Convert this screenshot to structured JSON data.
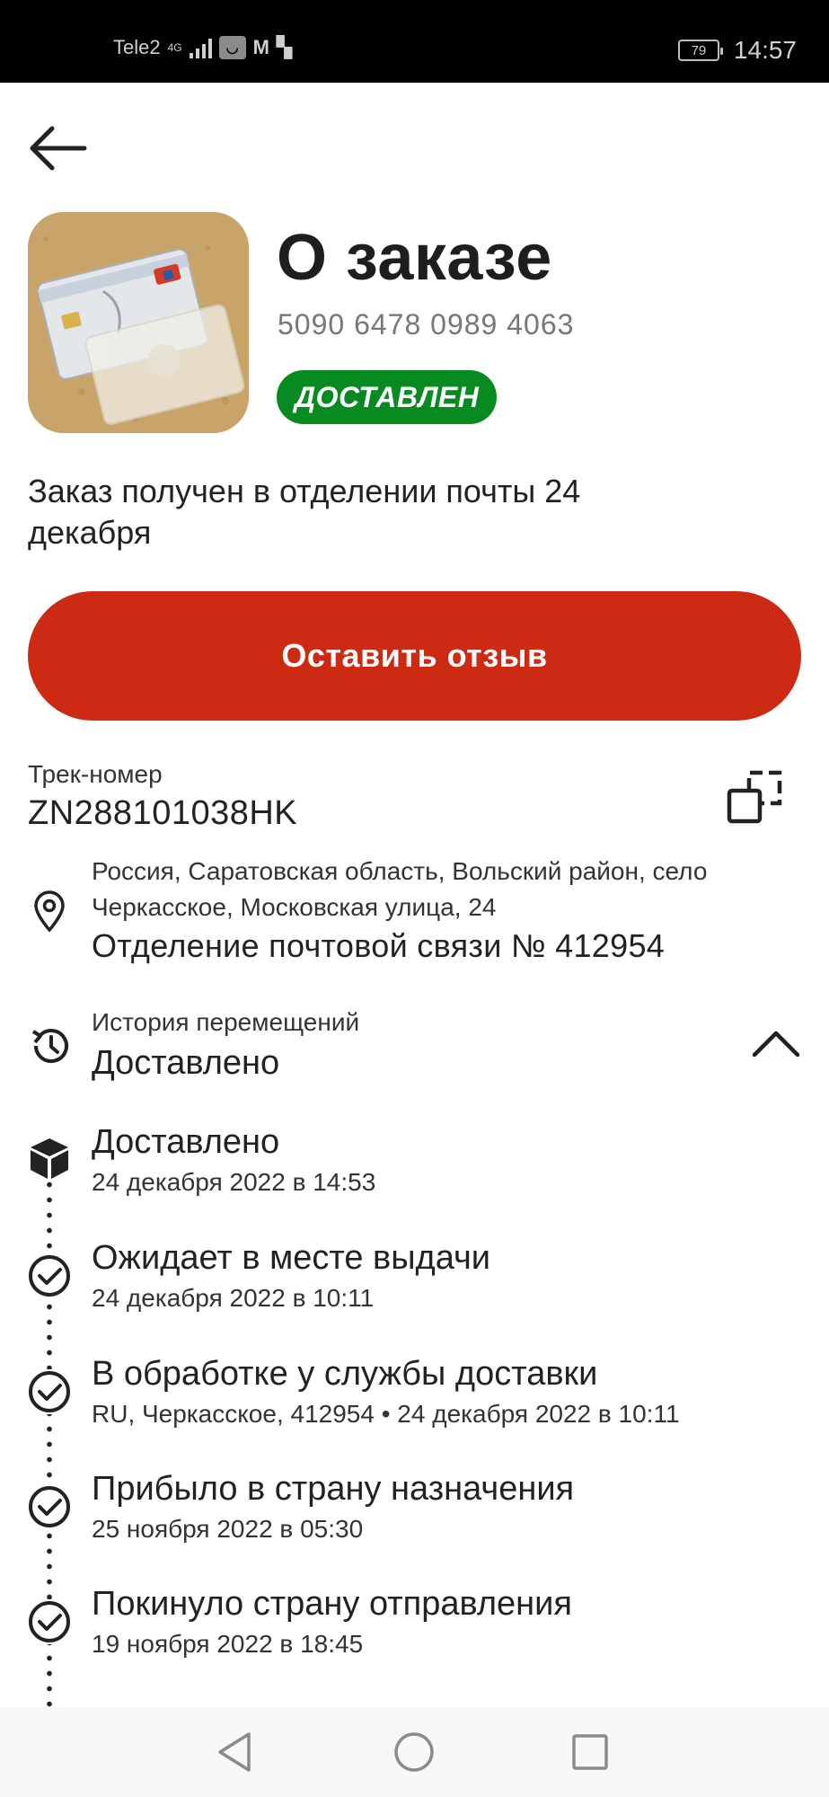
{
  "status_bar": {
    "carrier": "Tele2",
    "network": "4G",
    "app_badge": "◡",
    "battery": "79",
    "time": "14:57"
  },
  "header": {
    "title": "О заказе",
    "order_number": "5090 6478 0989 4063",
    "status_badge": "ДОСТАВЛЕН",
    "badge_color": "#078a1f"
  },
  "order": {
    "received_text": "Заказ получен в отделении почты 24 декабря",
    "review_button": "Оставить отзыв",
    "accent_color": "#cc2a12"
  },
  "tracking": {
    "label": "Трек-номер",
    "number": "ZN288101038HK"
  },
  "address": {
    "line": "Россия, Саратовская область, Вольский район, село Черкасское, Московская улица, 24",
    "office": "Отделение почтовой связи № 412954"
  },
  "history": {
    "label": "История перемещений",
    "current_status": "Доставлено",
    "events": [
      {
        "title": "Доставлено",
        "subtitle": "24 декабря 2022 в 14:53",
        "icon": "box-icon"
      },
      {
        "title": "Ожидает в месте выдачи",
        "subtitle": "24 декабря 2022 в 10:11",
        "icon": "check-circle-icon"
      },
      {
        "title": "В обработке у службы доставки",
        "subtitle": "RU, Черкасское, 412954 • 24 декабря 2022 в 10:11",
        "icon": "check-circle-icon"
      },
      {
        "title": "Прибыло в страну назначения",
        "subtitle": "25 ноября 2022 в 05:30",
        "icon": "check-circle-icon"
      },
      {
        "title": "Покинуло страну отправления",
        "subtitle": "19 ноября 2022 в 18:45",
        "icon": "check-circle-icon"
      }
    ]
  },
  "nav_bar": {
    "back": "nav-back-icon",
    "home": "nav-home-icon",
    "recents": "nav-recents-icon"
  }
}
